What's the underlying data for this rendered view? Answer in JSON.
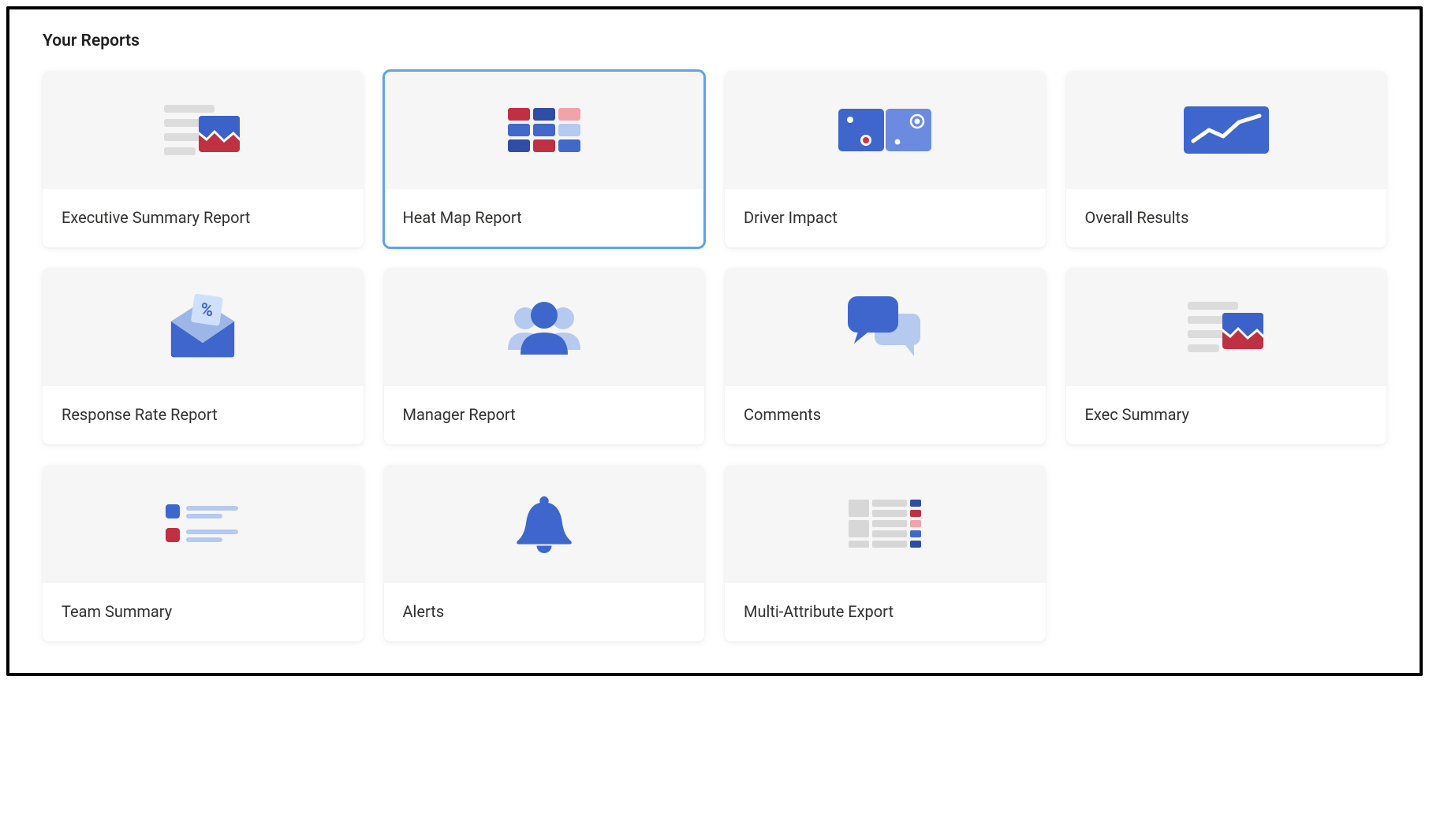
{
  "page": {
    "title": "Your Reports"
  },
  "reports": [
    {
      "title": "Executive Summary Report",
      "icon": "exec-summary-icon",
      "selected": false
    },
    {
      "title": "Heat Map Report",
      "icon": "heatmap-icon",
      "selected": true
    },
    {
      "title": "Driver Impact",
      "icon": "driver-impact-icon",
      "selected": false
    },
    {
      "title": "Overall Results",
      "icon": "overall-results-icon",
      "selected": false
    },
    {
      "title": "Response Rate Report",
      "icon": "response-rate-icon",
      "selected": false
    },
    {
      "title": "Manager Report",
      "icon": "manager-report-icon",
      "selected": false
    },
    {
      "title": "Comments",
      "icon": "comments-icon",
      "selected": false
    },
    {
      "title": "Exec Summary",
      "icon": "exec-summary-icon",
      "selected": false
    },
    {
      "title": "Team Summary",
      "icon": "team-summary-icon",
      "selected": false
    },
    {
      "title": "Alerts",
      "icon": "alerts-icon",
      "selected": false
    },
    {
      "title": "Multi-Attribute Export",
      "icon": "multi-attribute-icon",
      "selected": false
    }
  ],
  "colors": {
    "blue": "#4268c9",
    "blueDark": "#2f4da3",
    "blueLight": "#9cb6e8",
    "red": "#c03043",
    "redLight": "#f1a3aa",
    "grey": "#dcdcdc",
    "greyLight": "#e4e4e4"
  }
}
